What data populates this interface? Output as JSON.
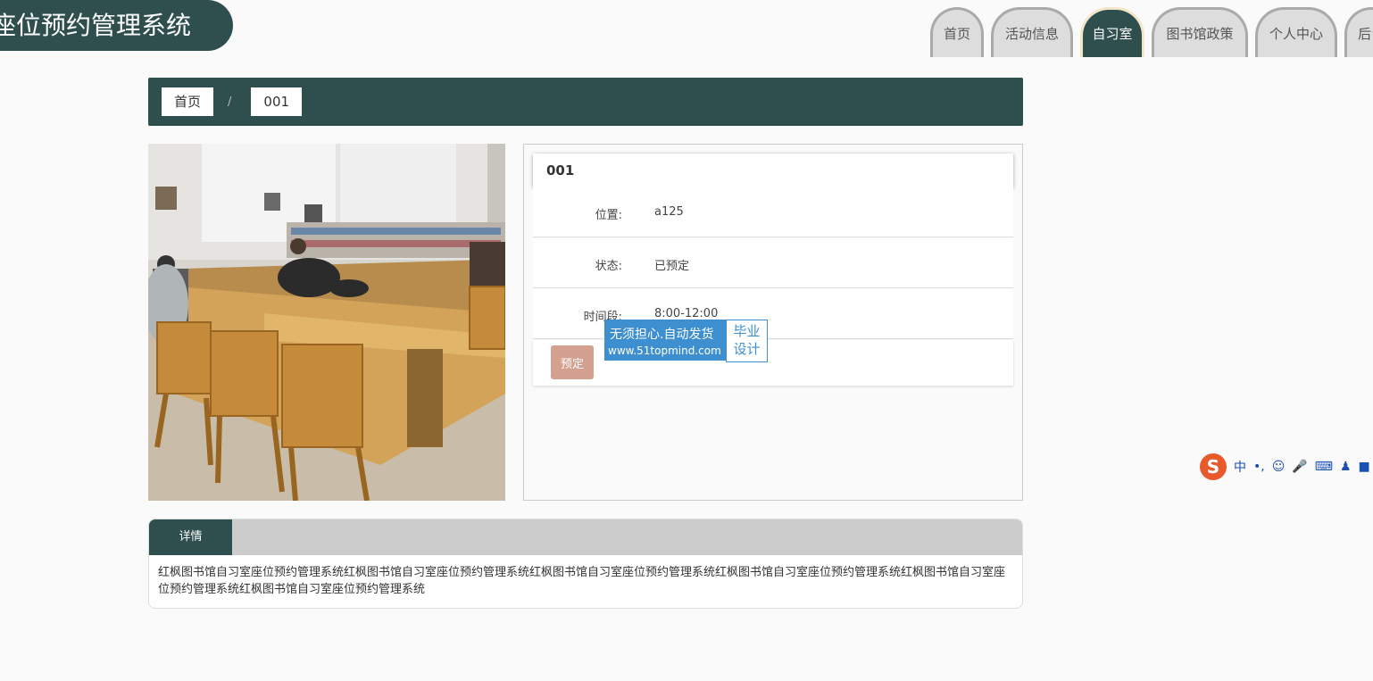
{
  "app": {
    "title": "座位预约管理系统"
  },
  "nav": {
    "items": [
      {
        "label": "首页",
        "active": false
      },
      {
        "label": "活动信息",
        "active": false
      },
      {
        "label": "自习室",
        "active": true
      },
      {
        "label": "图书馆政策",
        "active": false
      },
      {
        "label": "个人中心",
        "active": false
      },
      {
        "label": "后台",
        "active": false
      }
    ]
  },
  "breadcrumb": {
    "home": "首页",
    "separator": "/",
    "current": "001"
  },
  "room": {
    "title": "001",
    "location_label": "位置:",
    "location_value": "a125",
    "status_label": "状态:",
    "status_value": "已预定",
    "time_label": "时间段:",
    "time_value": "8:00-12:00",
    "book_button": "预定"
  },
  "watermark": {
    "line1": "无须担心.自动发货",
    "line2": "www.51topmind.com",
    "badge_line1": "毕业",
    "badge_line2": "设计"
  },
  "details": {
    "tab_label": "详情",
    "text": "红枫图书馆自习室座位预约管理系统红枫图书馆自习室座位预约管理系统红枫图书馆自习室座位预约管理系统红枫图书馆自习室座位预约管理系统红枫图书馆自习室座位预约管理系统红枫图书馆自习室座位预约管理系统"
  },
  "ime": {
    "logo": "S",
    "lang": "中",
    "punct": "•,",
    "icons": [
      "emoji-icon",
      "mic-icon",
      "keyboard-icon",
      "user-icon",
      "shirt-icon"
    ]
  },
  "colors": {
    "primary": "#2f4f4f",
    "nav_inactive": "#dddddd",
    "book_button": "#d4a090",
    "watermark": "#3e8fd0"
  }
}
